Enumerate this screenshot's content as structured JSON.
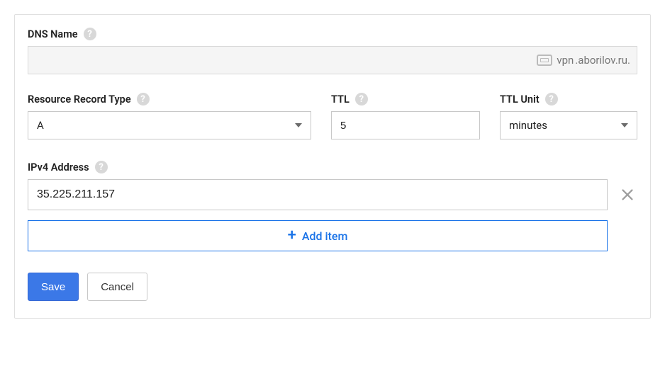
{
  "dnsName": {
    "label": "DNS Name",
    "value": "",
    "suffixPrefix": "vpn",
    "suffixDomain": ".aborilov.ru."
  },
  "recordType": {
    "label": "Resource Record Type",
    "value": "A"
  },
  "ttl": {
    "label": "TTL",
    "value": "5"
  },
  "ttlUnit": {
    "label": "TTL Unit",
    "value": "minutes"
  },
  "ipv4": {
    "label": "IPv4 Address",
    "items": [
      "35.225.211.157"
    ],
    "addItemLabel": "Add item"
  },
  "actions": {
    "save": "Save",
    "cancel": "Cancel"
  }
}
